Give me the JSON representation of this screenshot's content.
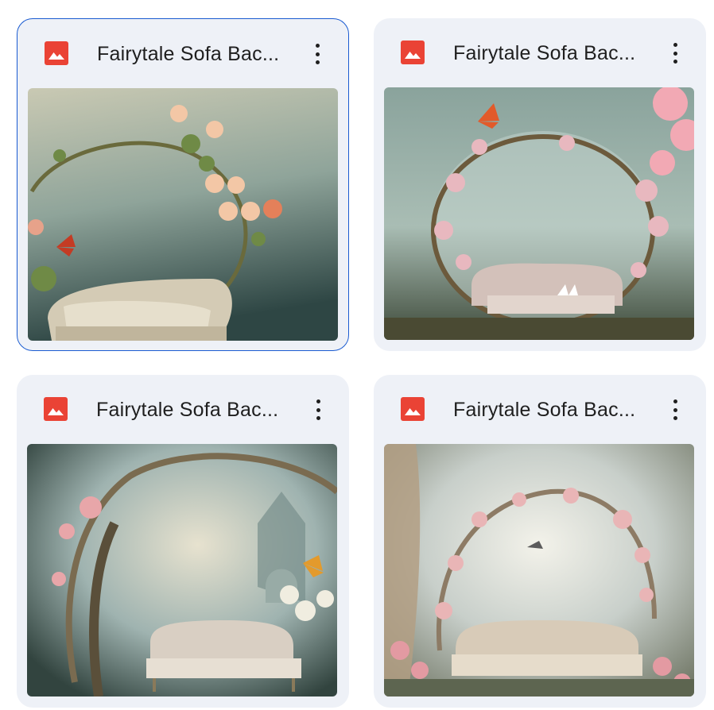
{
  "files": [
    {
      "title": "Fairytale Sofa Bac...",
      "icon": "image-file-icon",
      "selected": true
    },
    {
      "title": "Fairytale Sofa Bac...",
      "icon": "image-file-icon",
      "selected": false
    },
    {
      "title": "Fairytale Sofa Bac...",
      "icon": "image-file-icon",
      "selected": false
    },
    {
      "title": "Fairytale Sofa Bac...",
      "icon": "image-file-icon",
      "selected": false
    }
  ],
  "colors": {
    "file_icon": "#ea4335",
    "selected_border": "#1a5bd1",
    "card_bg": "#eef1f7"
  }
}
